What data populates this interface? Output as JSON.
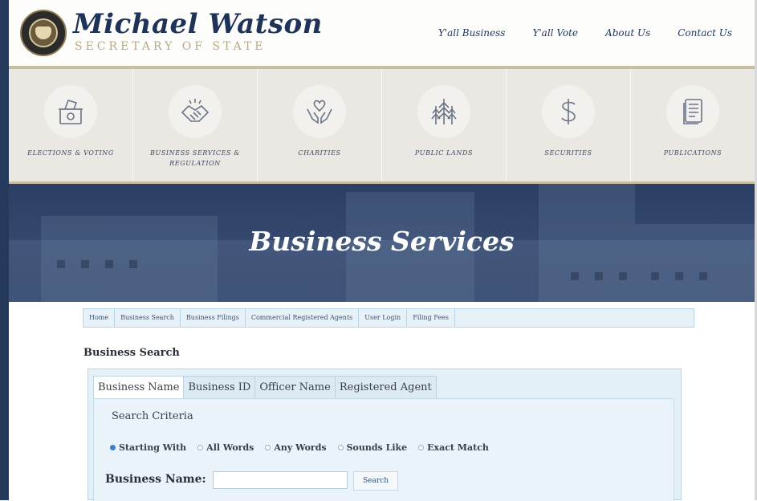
{
  "header": {
    "name": "Michael Watson",
    "subtitle": "SECRETARY OF STATE",
    "nav": [
      "Y'all Business",
      "Y'all Vote",
      "About Us",
      "Contact Us"
    ]
  },
  "tiles": [
    {
      "label": "ELECTIONS & VOTING",
      "icon": "ballot-box-icon"
    },
    {
      "label": "BUSINESS SERVICES & REGULATION",
      "icon": "handshake-icon"
    },
    {
      "label": "CHARITIES",
      "icon": "hands-heart-icon"
    },
    {
      "label": "PUBLIC LANDS",
      "icon": "trees-icon"
    },
    {
      "label": "SECURITIES",
      "icon": "dollar-icon"
    },
    {
      "label": "PUBLICATIONS",
      "icon": "document-icon"
    }
  ],
  "banner": {
    "title": "Business Services"
  },
  "breadcrumbs": [
    "Home",
    "Business Search",
    "Business Filings",
    "Commercial Registered Agents",
    "User Login",
    "Filing Fees"
  ],
  "search": {
    "title": "Business Search",
    "tabs": [
      "Business Name",
      "Business ID",
      "Officer Name",
      "Registered Agent"
    ],
    "active_tab": "Business Name",
    "criteria_label": "Search Criteria",
    "options": [
      "Starting With",
      "All Words",
      "Any Words",
      "Sounds Like",
      "Exact Match"
    ],
    "selected_option": "Starting With",
    "field_label": "Business Name:",
    "field_value": "",
    "button_label": "Search"
  }
}
